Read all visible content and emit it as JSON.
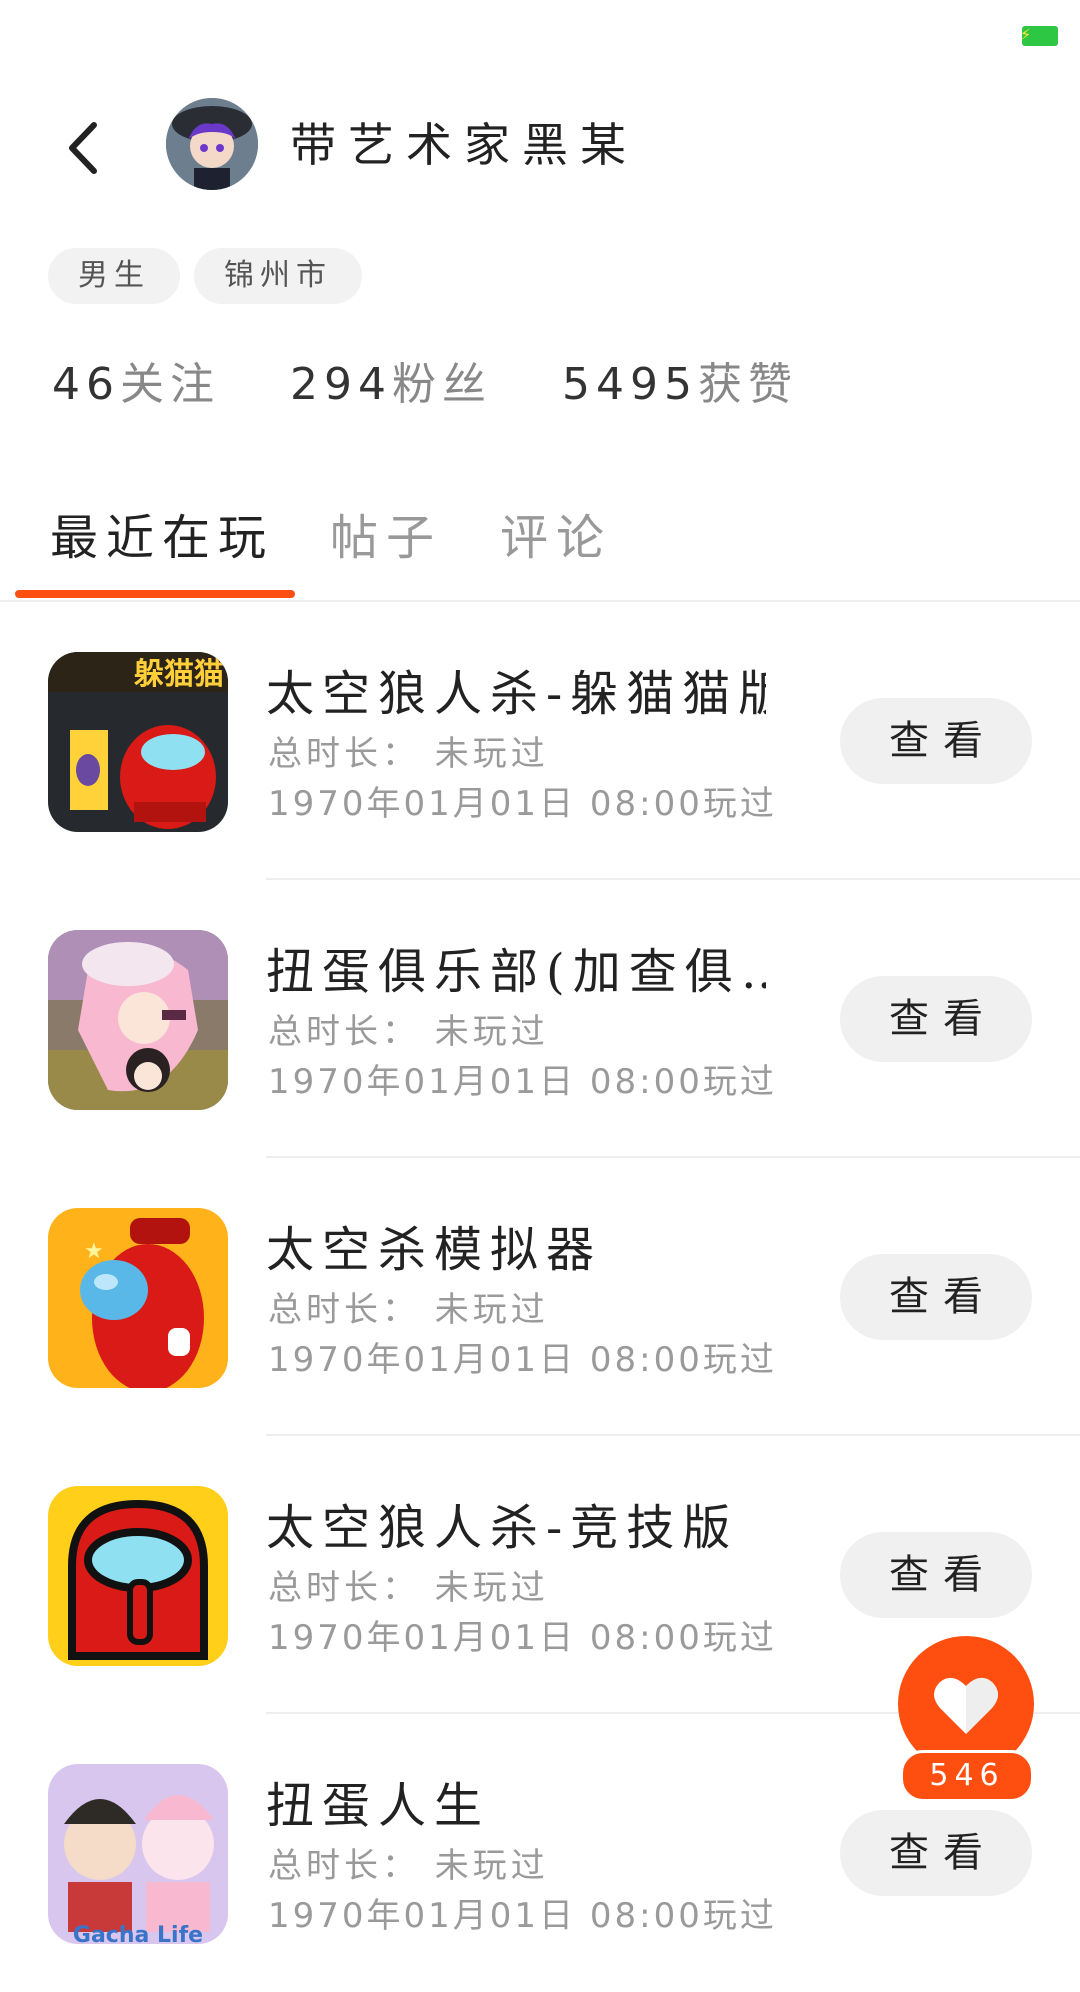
{
  "status_bar": {
    "battery_color": "#2ec744"
  },
  "profile": {
    "username": "带艺术家黑某",
    "tags": [
      "男生",
      "锦州市"
    ],
    "stats": [
      {
        "value": "46",
        "label": "关注"
      },
      {
        "value": "294",
        "label": "粉丝"
      },
      {
        "value": "5495",
        "label": "获赞"
      }
    ]
  },
  "tabs": [
    {
      "label": "最近在玩",
      "active": true
    },
    {
      "label": "帖子",
      "active": false
    },
    {
      "label": "评论",
      "active": false
    }
  ],
  "games": [
    {
      "title": "太空狼人杀-躲猫猫版",
      "duration": "总时长：  未玩过",
      "last_played": "1970年01月01日  08:00玩过",
      "button": "查看",
      "icon_badge": "躲猫猫"
    },
    {
      "title": "扭蛋俱乐部(加查俱…",
      "duration": "总时长：  未玩过",
      "last_played": "1970年01月01日  08:00玩过",
      "button": "查看"
    },
    {
      "title": "太空杀模拟器",
      "duration": "总时长：  未玩过",
      "last_played": "1970年01月01日  08:00玩过",
      "button": "查看"
    },
    {
      "title": "太空狼人杀-竞技版",
      "duration": "总时长：  未玩过",
      "last_played": "1970年01月01日  08:00玩过",
      "button": "查看"
    },
    {
      "title": "扭蛋人生",
      "duration": "总时长：  未玩过",
      "last_played": "1970年01月01日  08:00玩过",
      "button": "查看",
      "icon_badge": "Gacha Life"
    }
  ],
  "like_fab": {
    "count": "546",
    "color": "#ff4f10"
  },
  "accent_color": "#ff4f10"
}
